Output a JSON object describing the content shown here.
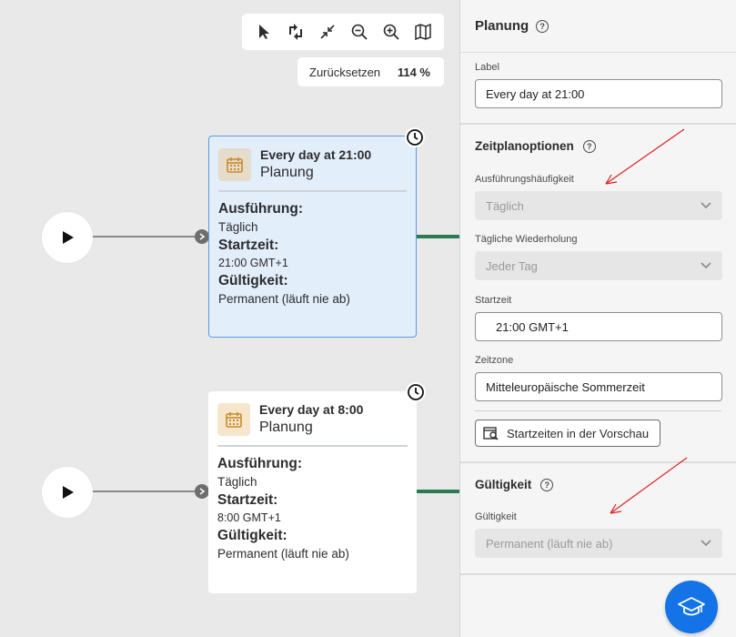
{
  "toolbar": {
    "tools": [
      "select-pointer-icon",
      "auto-layout-icon",
      "collapse-icon",
      "zoom-out-icon",
      "zoom-in-icon",
      "map-icon"
    ],
    "reset_label": "Zurücksetzen",
    "zoom_level": "114 %"
  },
  "nodes": [
    {
      "title": "Every day at 21:00",
      "subtitle": "Planung",
      "key_execution": "Ausführung:",
      "val_execution": "Täglich",
      "key_start": "Startzeit:",
      "val_start": "21:00 GMT+1",
      "key_validity": "Gültigkeit:",
      "val_validity": "Permanent (läuft nie ab)"
    },
    {
      "title": "Every day at 8:00",
      "subtitle": "Planung",
      "key_execution": "Ausführung:",
      "val_execution": "Täglich",
      "key_start": "Startzeit:",
      "val_start": "8:00 GMT+1",
      "key_validity": "Gültigkeit:",
      "val_validity": "Permanent (läuft nie ab)"
    }
  ],
  "panel": {
    "title": "Planung",
    "label_field": {
      "label": "Label",
      "value": "Every day at 21:00"
    },
    "schedule_options": {
      "title": "Zeitplanoptionen",
      "frequency": {
        "label": "Ausführungshäufigkeit",
        "value": "Täglich"
      },
      "daily_repeat": {
        "label": "Tägliche Wiederholung",
        "value": "Jeder Tag"
      },
      "start_time": {
        "label": "Startzeit",
        "value": "21:00 GMT+1"
      },
      "timezone": {
        "label": "Zeitzone",
        "value": "Mitteleuropäische Sommerzeit"
      },
      "preview_button": "Startzeiten in der Vorschau"
    },
    "validity": {
      "title": "Gültigkeit",
      "field_label": "Gültigkeit",
      "value": "Permanent (läuft nie ab)"
    }
  },
  "colors": {
    "accent": "#1473e6",
    "selected_border": "#5a9be6",
    "selected_bg": "#e3eefb",
    "connector_green": "#2d7a52",
    "annotation_red": "#e02020"
  }
}
